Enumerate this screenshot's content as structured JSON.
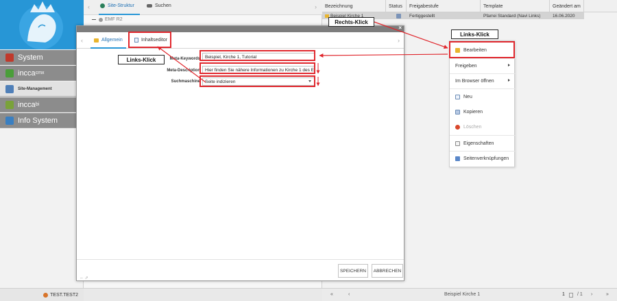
{
  "sidebar": {
    "items": [
      {
        "label": "System",
        "sup": ""
      },
      {
        "label": "incca",
        "sup": "cmx"
      },
      {
        "label": "Site-Management",
        "sup": ""
      },
      {
        "label": "incca",
        "sup": "bi"
      },
      {
        "label": "Info System",
        "sup": ""
      }
    ],
    "user": "TEST.TEST2"
  },
  "tree": {
    "tabs": [
      "Site-Struktur",
      "Suchen"
    ],
    "root": "EMF R2"
  },
  "grid": {
    "columns": [
      "Bezeichnung",
      "Status",
      "Freigabestufe",
      "Template",
      "Geändert am"
    ],
    "row": {
      "bezeichnung": "Beispiel Kirche 1",
      "freigabestufe": "Fertiggestellt",
      "template": "Pfarrei Standard (Navi Links)",
      "geaendert": "16.06.2020"
    },
    "footer": {
      "title": "Beispiel Kirche 1",
      "page": "1",
      "of": "/ 1"
    }
  },
  "dialog": {
    "tabs": [
      "Allgemein",
      "Inhaltseditor"
    ],
    "fields": [
      {
        "label": "Meta-Keywords",
        "value": "Beispiel, Kirche 1, Tutorial"
      },
      {
        "label": "Meta-Description",
        "value": "Hier finden Sie nähere Informationen zu Kirche 1 des E"
      },
      {
        "label": "Suchmaschine",
        "value": "Seite indizieren"
      }
    ],
    "buttons": {
      "save": "SPEICHERN",
      "cancel": "ABBRECHEN"
    },
    "close": "×"
  },
  "context_menu": {
    "items": [
      {
        "label": "Bearbeiten",
        "icon": "folder-icon",
        "disabled": false,
        "submenu": false
      },
      {
        "label": "Freigeben",
        "icon": "",
        "disabled": false,
        "submenu": true
      },
      {
        "label": "Im Browser öffnen",
        "icon": "",
        "disabled": false,
        "submenu": true
      },
      {
        "label": "Neu",
        "icon": "new-page-icon",
        "disabled": false,
        "submenu": false
      },
      {
        "label": "Kopieren",
        "icon": "copy-icon",
        "disabled": false,
        "submenu": false
      },
      {
        "label": "Löschen",
        "icon": "delete-icon",
        "disabled": true,
        "submenu": false
      },
      {
        "label": "Eigenschaften",
        "icon": "properties-icon",
        "disabled": false,
        "submenu": false
      },
      {
        "label": "Seitenverknüpfungen",
        "icon": "links-icon",
        "disabled": false,
        "submenu": false
      }
    ]
  },
  "annotations": {
    "rechts_klick": "Rechts-Klick",
    "links_klick_menu": "Links-Klick",
    "links_klick_tab": "Links-Klick"
  },
  "colors": {
    "accent": "#2796d6",
    "highlight_red": "#e0262c",
    "nav_gray": "#8c8c8c"
  }
}
